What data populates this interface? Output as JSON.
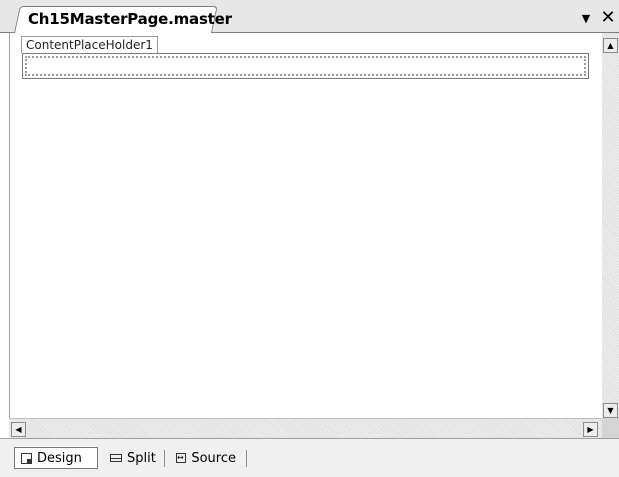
{
  "document_tab": {
    "title": "Ch15MasterPage.master",
    "dropdown_icon": "▼",
    "close_icon": "✕"
  },
  "design_surface": {
    "content_placeholder_label": "ContentPlaceHolder1"
  },
  "scrollbars": {
    "up_icon": "▲",
    "down_icon": "▼",
    "left_icon": "◀",
    "right_icon": "▶"
  },
  "view_bar": {
    "active": "Design",
    "buttons": [
      {
        "label": "Design",
        "icon": "design-icon"
      },
      {
        "label": "Split",
        "icon": "split-icon"
      },
      {
        "label": "Source",
        "icon": "source-icon"
      }
    ]
  }
}
